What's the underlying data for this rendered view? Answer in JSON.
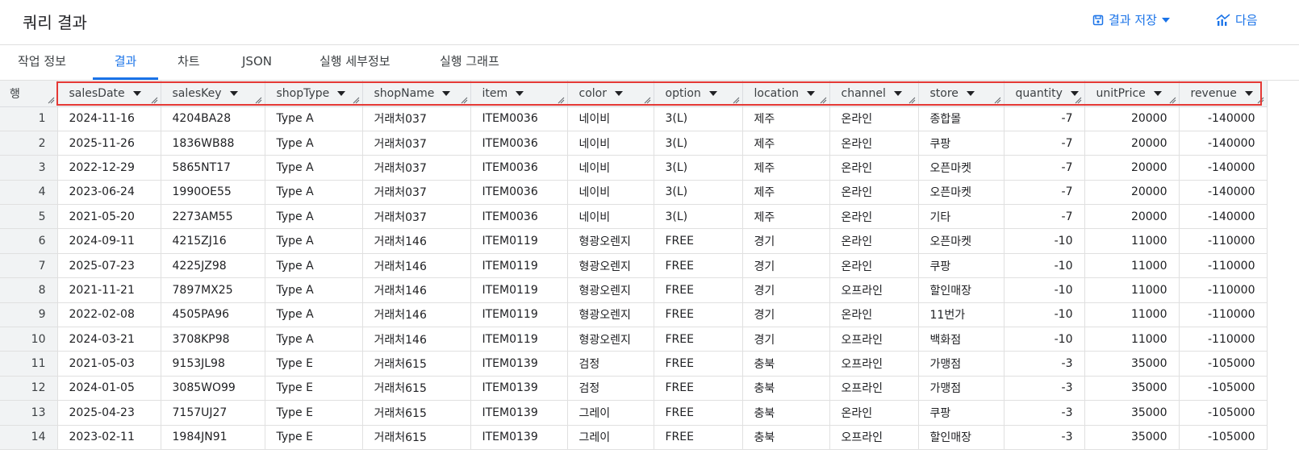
{
  "header": {
    "title": "쿼리 결과",
    "save_label": "결과 저장",
    "next_label": "다음"
  },
  "tabs": [
    {
      "label": "작업 정보",
      "active": false
    },
    {
      "label": "결과",
      "active": true
    },
    {
      "label": "차트",
      "active": false
    },
    {
      "label": "JSON",
      "active": false
    },
    {
      "label": "실행 세부정보",
      "active": false
    },
    {
      "label": "실행 그래프",
      "active": false
    }
  ],
  "table": {
    "rownum_header": "행",
    "columns": [
      "salesDate",
      "salesKey",
      "shopType",
      "shopName",
      "item",
      "color",
      "option",
      "location",
      "channel",
      "store",
      "quantity",
      "unitPrice",
      "revenue"
    ],
    "rows": [
      [
        "1",
        "2024-11-16",
        "4204BA28",
        "Type A",
        "거래처037",
        "ITEM0036",
        "네이비",
        "3(L)",
        "제주",
        "온라인",
        "종합몰",
        "-7",
        "20000",
        "-140000"
      ],
      [
        "2",
        "2025-11-26",
        "1836WB88",
        "Type A",
        "거래처037",
        "ITEM0036",
        "네이비",
        "3(L)",
        "제주",
        "온라인",
        "쿠팡",
        "-7",
        "20000",
        "-140000"
      ],
      [
        "3",
        "2022-12-29",
        "5865NT17",
        "Type A",
        "거래처037",
        "ITEM0036",
        "네이비",
        "3(L)",
        "제주",
        "온라인",
        "오픈마켓",
        "-7",
        "20000",
        "-140000"
      ],
      [
        "4",
        "2023-06-24",
        "1990OE55",
        "Type A",
        "거래처037",
        "ITEM0036",
        "네이비",
        "3(L)",
        "제주",
        "온라인",
        "오픈마켓",
        "-7",
        "20000",
        "-140000"
      ],
      [
        "5",
        "2021-05-20",
        "2273AM55",
        "Type A",
        "거래처037",
        "ITEM0036",
        "네이비",
        "3(L)",
        "제주",
        "온라인",
        "기타",
        "-7",
        "20000",
        "-140000"
      ],
      [
        "6",
        "2024-09-11",
        "4215ZJ16",
        "Type A",
        "거래처146",
        "ITEM0119",
        "형광오렌지",
        "FREE",
        "경기",
        "온라인",
        "오픈마켓",
        "-10",
        "11000",
        "-110000"
      ],
      [
        "7",
        "2025-07-23",
        "4225JZ98",
        "Type A",
        "거래처146",
        "ITEM0119",
        "형광오렌지",
        "FREE",
        "경기",
        "온라인",
        "쿠팡",
        "-10",
        "11000",
        "-110000"
      ],
      [
        "8",
        "2021-11-21",
        "7897MX25",
        "Type A",
        "거래처146",
        "ITEM0119",
        "형광오렌지",
        "FREE",
        "경기",
        "오프라인",
        "할인매장",
        "-10",
        "11000",
        "-110000"
      ],
      [
        "9",
        "2022-02-08",
        "4505PA96",
        "Type A",
        "거래처146",
        "ITEM0119",
        "형광오렌지",
        "FREE",
        "경기",
        "온라인",
        "11번가",
        "-10",
        "11000",
        "-110000"
      ],
      [
        "10",
        "2024-03-21",
        "3708KP98",
        "Type A",
        "거래처146",
        "ITEM0119",
        "형광오렌지",
        "FREE",
        "경기",
        "오프라인",
        "백화점",
        "-10",
        "11000",
        "-110000"
      ],
      [
        "11",
        "2021-05-03",
        "9153JL98",
        "Type E",
        "거래처615",
        "ITEM0139",
        "검정",
        "FREE",
        "충북",
        "오프라인",
        "가맹점",
        "-3",
        "35000",
        "-105000"
      ],
      [
        "12",
        "2024-01-05",
        "3085WO99",
        "Type E",
        "거래처615",
        "ITEM0139",
        "검정",
        "FREE",
        "충북",
        "오프라인",
        "가맹점",
        "-3",
        "35000",
        "-105000"
      ],
      [
        "13",
        "2025-04-23",
        "7157UJ27",
        "Type E",
        "거래처615",
        "ITEM0139",
        "그레이",
        "FREE",
        "충북",
        "온라인",
        "쿠팡",
        "-3",
        "35000",
        "-105000"
      ],
      [
        "14",
        "2023-02-11",
        "1984JN91",
        "Type E",
        "거래처615",
        "ITEM0139",
        "그레이",
        "FREE",
        "충북",
        "오프라인",
        "할인매장",
        "-3",
        "35000",
        "-105000"
      ]
    ]
  },
  "colors": {
    "accent": "#1a73e8",
    "highlight": "#e53935",
    "header_bg": "#f1f3f4"
  }
}
